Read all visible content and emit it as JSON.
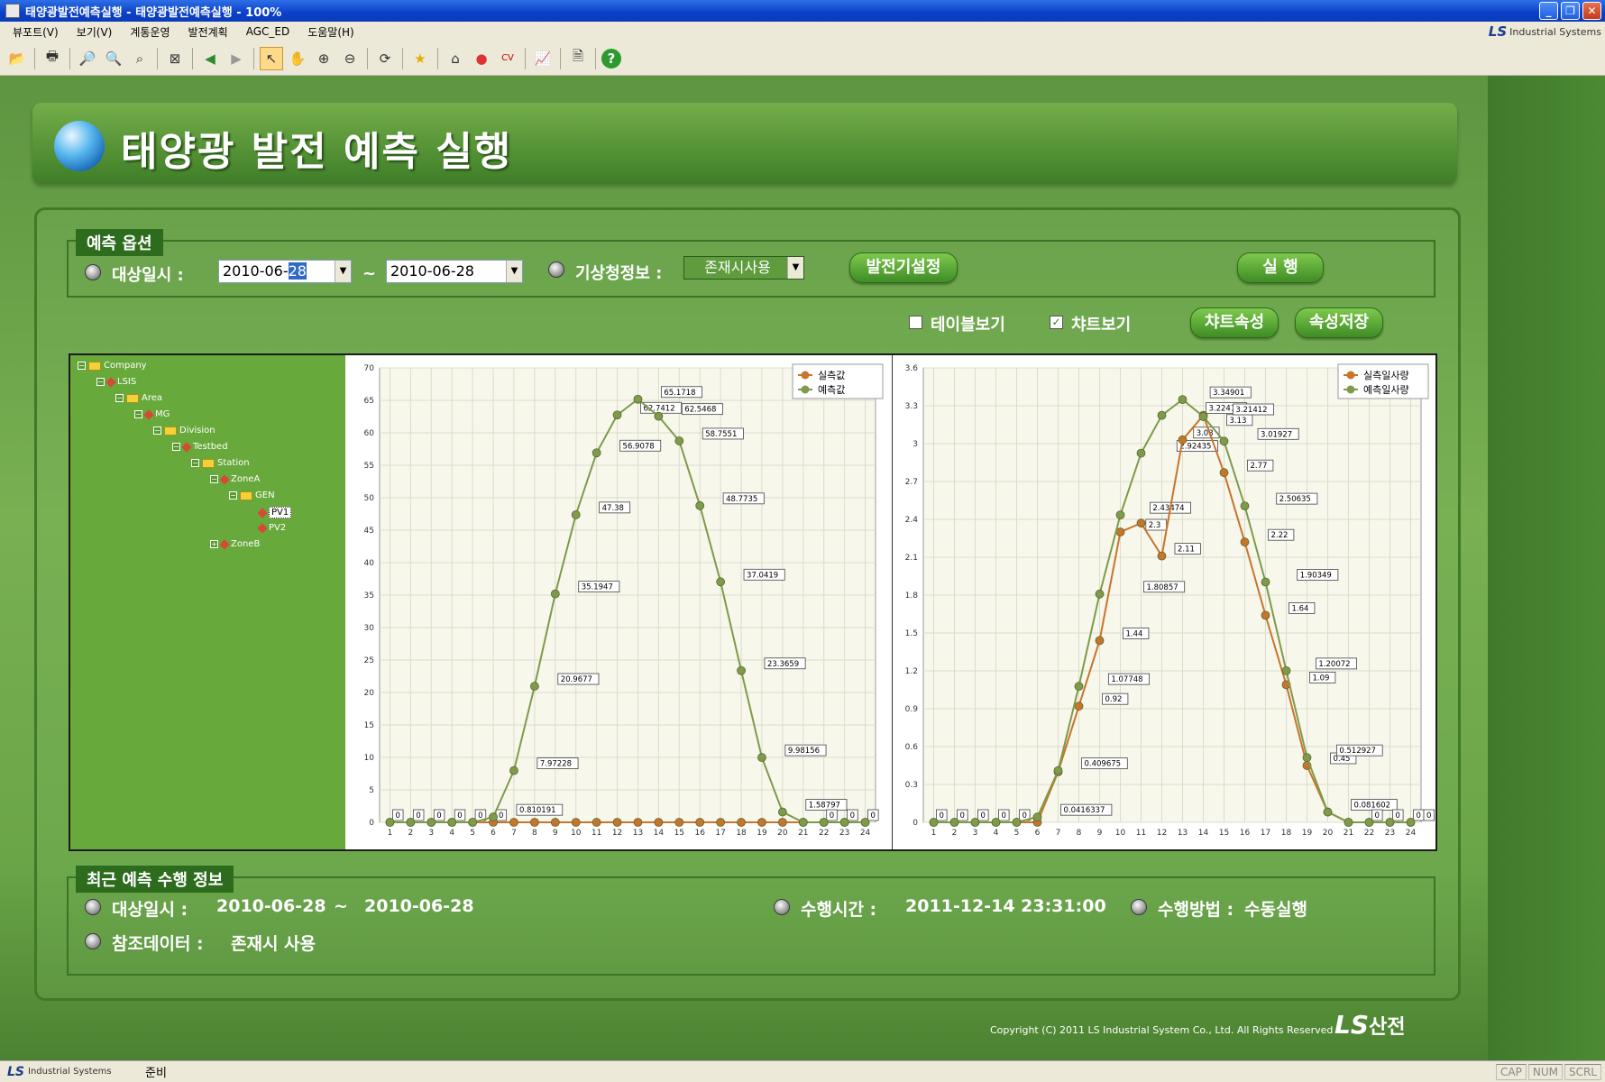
{
  "window": {
    "title": "태양광발전예측실행 - 태양광발전예측실행 - 100%"
  },
  "menu": [
    "뷰포트(V)",
    "보기(V)",
    "계통운영",
    "발전계획",
    "AGC_ED",
    "도움말(H)"
  ],
  "brand": {
    "top_text": "Industrial Systems",
    "bottom_text": "Industrial Systems",
    "logo": "LS",
    "footer_logo_text": "산전"
  },
  "page": {
    "title": "태양광 발전 예측 실행"
  },
  "options": {
    "group_label": "예측 옵션",
    "target_date_label": "대상일시 :",
    "date_from_prefix": "2010-06-",
    "date_from_selected": "28",
    "range_sep": "~",
    "date_to": "2010-06-28",
    "weather_label": "기상청정보 :",
    "weather_value": "존재시사용",
    "generator_setting_button": "발전기설정",
    "run_button": "실    행",
    "table_view_label": "테이블보기",
    "chart_view_label": "챠트보기",
    "chart_props_button": "챠트속성",
    "save_props_button": "속성저장"
  },
  "tree": [
    {
      "label": "Company",
      "icon": "folder-icon",
      "level": 0
    },
    {
      "label": "LSIS",
      "icon": "diamond-icon",
      "level": 1
    },
    {
      "label": "Area",
      "icon": "folder-icon",
      "level": 2
    },
    {
      "label": "MG",
      "icon": "diamond-icon",
      "level": 3
    },
    {
      "label": "Division",
      "icon": "folder-icon",
      "level": 4
    },
    {
      "label": "Testbed",
      "icon": "diamond-icon",
      "level": 5
    },
    {
      "label": "Station",
      "icon": "folder-icon",
      "level": 6
    },
    {
      "label": "ZoneA",
      "icon": "diamond-icon",
      "level": 7
    },
    {
      "label": "GEN",
      "icon": "folder-icon",
      "level": 8
    },
    {
      "label": "PV1",
      "icon": "diamond-icon",
      "level": 9,
      "selected": true
    },
    {
      "label": "PV2",
      "icon": "diamond-icon",
      "level": 9
    },
    {
      "label": "ZoneB",
      "icon": "diamond-icon",
      "level": 7
    }
  ],
  "chart_data": [
    {
      "type": "line",
      "x": [
        1,
        2,
        3,
        4,
        5,
        6,
        7,
        8,
        9,
        10,
        11,
        12,
        13,
        14,
        15,
        16,
        17,
        18,
        19,
        20,
        21,
        22,
        23,
        24
      ],
      "ylim": [
        0,
        70
      ],
      "yticks": [
        0,
        5,
        10,
        15,
        20,
        25,
        30,
        35,
        40,
        45,
        50,
        55,
        60,
        65,
        70
      ],
      "legend_position": "top-right",
      "series": [
        {
          "name": "실측값",
          "color": "#c8742a",
          "values": [
            0,
            0,
            0,
            0,
            0,
            0,
            0,
            0,
            0,
            0,
            0,
            0,
            0,
            0,
            0,
            0,
            0,
            0,
            0,
            0,
            0,
            0,
            0,
            0
          ]
        },
        {
          "name": "예측값",
          "color": "#7e9a4a",
          "values": [
            0,
            0,
            0,
            0,
            0,
            0.810191,
            7.97228,
            20.9677,
            35.1947,
            47.38,
            56.9078,
            62.7412,
            65.1718,
            62.5468,
            58.7551,
            48.7735,
            37.0419,
            23.3659,
            9.98156,
            1.58797,
            0,
            0,
            0,
            0
          ]
        }
      ],
      "point_labels": [
        {
          "x": 1,
          "text": "0"
        },
        {
          "x": 2,
          "text": "0"
        },
        {
          "x": 3,
          "text": "0"
        },
        {
          "x": 4,
          "text": "0"
        },
        {
          "x": 5,
          "text": "0"
        },
        {
          "x": 6,
          "text": "0"
        },
        {
          "x": 7,
          "text": "0.810191"
        },
        {
          "x": 8,
          "text": "7.97228"
        },
        {
          "x": 9,
          "text": "20.9677"
        },
        {
          "x": 10,
          "text": "35.1947"
        },
        {
          "x": 11,
          "text": "47.38"
        },
        {
          "x": 12,
          "text": "56.9078"
        },
        {
          "x": 13,
          "text": "62.7412"
        },
        {
          "x": 14,
          "text": "65.1718"
        },
        {
          "x": 15,
          "text": "62.5468"
        },
        {
          "x": 16,
          "text": "58.7551"
        },
        {
          "x": 17,
          "text": "48.7735"
        },
        {
          "x": 18,
          "text": "37.0419"
        },
        {
          "x": 19,
          "text": "23.3659"
        },
        {
          "x": 20,
          "text": "9.98156"
        },
        {
          "x": 21,
          "text": "1.58797"
        },
        {
          "x": 22,
          "text": "0"
        },
        {
          "x": 23,
          "text": "0"
        },
        {
          "x": 24,
          "text": "0"
        }
      ]
    },
    {
      "type": "line",
      "x": [
        1,
        2,
        3,
        4,
        5,
        6,
        7,
        8,
        9,
        10,
        11,
        12,
        13,
        14,
        15,
        16,
        17,
        18,
        19,
        20,
        21,
        22,
        23,
        24
      ],
      "ylim": [
        0,
        3.6
      ],
      "yticks": [
        0,
        0.3,
        0.6,
        0.9,
        1.2,
        1.5,
        1.8,
        2.1,
        2.4,
        2.7,
        3,
        3.3,
        3.6
      ],
      "legend_position": "top-right",
      "series": [
        {
          "name": "실측일사량",
          "color": "#c8742a",
          "values": [
            0,
            0,
            0,
            0,
            0,
            0,
            0.4,
            0.92,
            1.44,
            2.3,
            2.37,
            2.11,
            3.03,
            3.22411,
            2.77,
            2.22,
            1.64,
            1.09,
            0.45,
            0.081602,
            0,
            0,
            0,
            0
          ]
        },
        {
          "name": "예측일사량",
          "color": "#7e9a4a",
          "values": [
            0,
            0,
            0,
            0,
            0,
            0.0416337,
            0.409675,
            1.07748,
            1.80857,
            2.43474,
            2.92435,
            3.22411,
            3.34901,
            3.21412,
            3.01927,
            2.50635,
            1.90349,
            1.20072,
            0.512927,
            0.081602,
            0,
            0,
            0,
            0
          ]
        }
      ],
      "point_labels": [
        {
          "x": 1,
          "text": "0"
        },
        {
          "x": 2,
          "text": "0"
        },
        {
          "x": 3,
          "text": "0"
        },
        {
          "x": 4,
          "text": "0"
        },
        {
          "x": 5,
          "text": "0"
        },
        {
          "x": 7,
          "text": "0.0416337"
        },
        {
          "x": 8,
          "text": "0.409675"
        },
        {
          "x": 9,
          "text": "0.92"
        },
        {
          "x": 9.3,
          "text": "1.07748"
        },
        {
          "x": 10,
          "text": "1.44"
        },
        {
          "x": 11,
          "text": "1.80857"
        },
        {
          "x": 11.1,
          "text": "2.3"
        },
        {
          "x": 11.3,
          "text": "2.43474"
        },
        {
          "x": 12.5,
          "text": "2.11"
        },
        {
          "x": 12.6,
          "text": "2.92435"
        },
        {
          "x": 13.4,
          "text": "3.03"
        },
        {
          "x": 14,
          "text": "3.22411"
        },
        {
          "x": 14.2,
          "text": "3.34901"
        },
        {
          "x": 15,
          "text": "3.13"
        },
        {
          "x": 15.3,
          "text": "3.21412"
        },
        {
          "x": 16,
          "text": "2.77"
        },
        {
          "x": 16.5,
          "text": "3.01927"
        },
        {
          "x": 17,
          "text": "2.22"
        },
        {
          "x": 17.4,
          "text": "2.50635"
        },
        {
          "x": 18,
          "text": "1.64"
        },
        {
          "x": 18.4,
          "text": "1.90349"
        },
        {
          "x": 19,
          "text": "1.09"
        },
        {
          "x": 19.3,
          "text": "1.20072"
        },
        {
          "x": 20,
          "text": "0.45"
        },
        {
          "x": 20.3,
          "text": "0.512927"
        },
        {
          "x": 21,
          "text": "0.081602"
        },
        {
          "x": 22,
          "text": "0"
        },
        {
          "x": 23,
          "text": "0"
        },
        {
          "x": 24,
          "text": "0"
        },
        {
          "x": 25,
          "text": "0"
        }
      ]
    }
  ],
  "recent": {
    "group_label": "최근 예측 수행 정보",
    "target_date_label": "대상일시 :",
    "date_from": "2010-06-28",
    "range_sep": "~",
    "date_to": "2010-06-28",
    "run_time_label": "수행시간 :",
    "run_time_value": "2011-12-14  23:31:00",
    "run_method_label": "수행방법 :",
    "run_method_value": "수동실행",
    "ref_data_label": "참조데이터 :",
    "ref_data_value": "존재시 사용"
  },
  "footer": {
    "copyright": "Copyright (C) 2011 LS Industrial System Co., Ltd. All Rights Reserved"
  },
  "status": {
    "text": "준비",
    "cap": "CAP",
    "num": "NUM",
    "scrl": "SCRL"
  },
  "colors": {
    "accent_green": "#3e8c24",
    "actual": "#c8742a",
    "forecast": "#7e9a4a"
  }
}
